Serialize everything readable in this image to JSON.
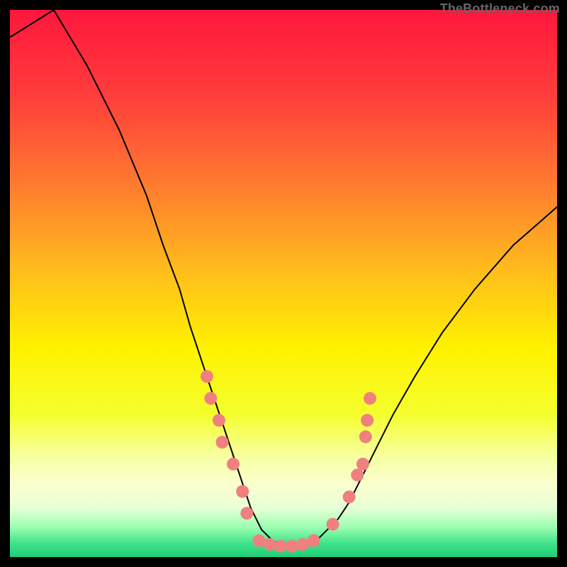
{
  "watermark": "TheBottleneck.com",
  "chart_data": {
    "type": "line",
    "title": "",
    "xlabel": "",
    "ylabel": "",
    "xlim": [
      0,
      100
    ],
    "ylim": [
      0,
      100
    ],
    "background": {
      "type": "vertical-gradient",
      "stops": [
        {
          "offset": 0.0,
          "color": "#ff173d"
        },
        {
          "offset": 0.16,
          "color": "#ff3e3b"
        },
        {
          "offset": 0.32,
          "color": "#ff7b2f"
        },
        {
          "offset": 0.48,
          "color": "#ffbe1b"
        },
        {
          "offset": 0.62,
          "color": "#fff200"
        },
        {
          "offset": 0.74,
          "color": "#f4ff2e"
        },
        {
          "offset": 0.82,
          "color": "#f8ffa6"
        },
        {
          "offset": 0.87,
          "color": "#faffd0"
        },
        {
          "offset": 0.91,
          "color": "#e8ffd6"
        },
        {
          "offset": 0.945,
          "color": "#9cffb2"
        },
        {
          "offset": 0.975,
          "color": "#3fe28a"
        },
        {
          "offset": 1.0,
          "color": "#1ecf78"
        }
      ]
    },
    "series": [
      {
        "name": "bottleneck-curve",
        "stroke": "#000000",
        "strokeWidth": 2,
        "x": [
          0,
          8,
          14,
          20,
          25,
          28,
          31,
          33,
          35,
          37,
          39,
          41,
          43,
          44,
          46,
          48,
          50,
          52,
          54,
          56,
          58,
          60,
          62,
          64,
          67,
          70,
          74,
          79,
          85,
          92,
          100
        ],
        "y": [
          95,
          100,
          90,
          78,
          66,
          57,
          49,
          42,
          36,
          30,
          24,
          18,
          12,
          9,
          5,
          3,
          2,
          2,
          2,
          3,
          5,
          7,
          10,
          14,
          20,
          26,
          33,
          41,
          49,
          57,
          64
        ]
      }
    ],
    "markers": {
      "name": "sample-dots",
      "color": "#f08080",
      "radius": 9,
      "points": [
        {
          "x": 36.0,
          "y": 33
        },
        {
          "x": 36.7,
          "y": 29
        },
        {
          "x": 38.2,
          "y": 25
        },
        {
          "x": 38.8,
          "y": 21
        },
        {
          "x": 40.8,
          "y": 17
        },
        {
          "x": 42.5,
          "y": 12
        },
        {
          "x": 43.3,
          "y": 8
        },
        {
          "x": 45.5,
          "y": 3.0
        },
        {
          "x": 47.5,
          "y": 2.3
        },
        {
          "x": 49.5,
          "y": 2.0
        },
        {
          "x": 51.5,
          "y": 2.0
        },
        {
          "x": 53.5,
          "y": 2.3
        },
        {
          "x": 55.5,
          "y": 3.0
        },
        {
          "x": 59.0,
          "y": 6
        },
        {
          "x": 62.0,
          "y": 11
        },
        {
          "x": 63.5,
          "y": 15
        },
        {
          "x": 64.5,
          "y": 17
        },
        {
          "x": 65.0,
          "y": 22
        },
        {
          "x": 65.3,
          "y": 25
        },
        {
          "x": 65.8,
          "y": 29
        }
      ]
    }
  }
}
